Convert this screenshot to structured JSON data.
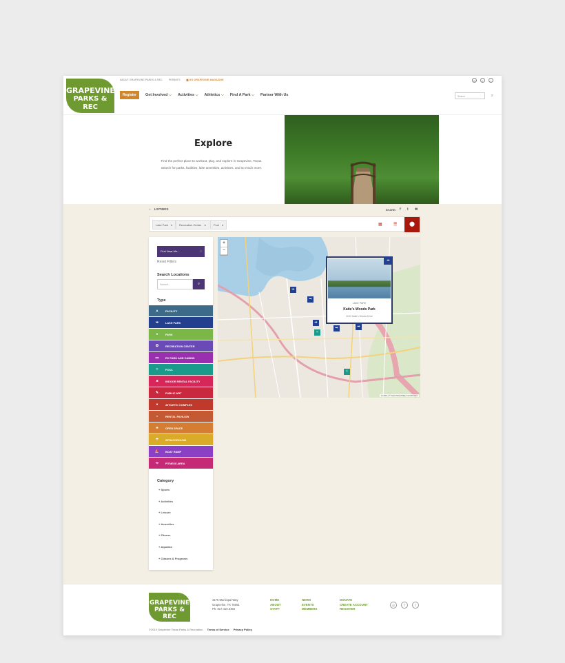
{
  "header": {
    "logo_line1": "GRAPEVINE",
    "logo_line2": "PARKS & REC",
    "util_links": [
      "ABOUT GRAPEVINE PARKS & REC",
      "PERMITS"
    ],
    "magazine_label": "GO GRAPEVINE MAGAZINE",
    "register_label": "Register",
    "nav": [
      "Get Involved",
      "Activities",
      "Athletics",
      "Find A Park",
      "Partner With Us"
    ],
    "search_placeholder": "Search",
    "social_icons": [
      "instagram-icon",
      "facebook-icon",
      "twitter-icon"
    ]
  },
  "hero": {
    "title": "Explore",
    "description": "Find the perfect place to workout, play, and explore in Grapevine, Texas. Search for parks, facilities, lake amenities, activities, and so much more."
  },
  "listing": {
    "breadcrumb": "LISTINGS",
    "share_label": "SHARE:",
    "filters": [
      "Lake Park",
      "Recreation Center",
      "Pool"
    ]
  },
  "sidebar": {
    "find_near_label": "Find Near Me...",
    "reset_label": "Reset Filters",
    "search_heading": "Search Locations",
    "search_placeholder": "Search...",
    "type_heading": "Type",
    "types": [
      {
        "label": "FACILITY",
        "color": "#3e6a8a"
      },
      {
        "label": "LAKE PARK",
        "color": "#253f8f"
      },
      {
        "label": "PARK",
        "color": "#7ab648"
      },
      {
        "label": "RECREATION CENTER",
        "color": "#6a4bb5"
      },
      {
        "label": "RV PARK AND CABINS",
        "color": "#9a2fb0"
      },
      {
        "label": "POOL",
        "color": "#1a9a8a"
      },
      {
        "label": "INDOOR RENTAL FACILITY",
        "color": "#d6265a"
      },
      {
        "label": "PUBLIC ART",
        "color": "#c9283e"
      },
      {
        "label": "ATHLETIC COMPLEX",
        "color": "#bf3a2c"
      },
      {
        "label": "RENTAL PAVILION",
        "color": "#c45a33"
      },
      {
        "label": "OPEN SPACE",
        "color": "#d67d34"
      },
      {
        "label": "SPRAYGROUND",
        "color": "#d9ab29"
      },
      {
        "label": "BOAT RAMP",
        "color": "#8a3fc4"
      },
      {
        "label": "FITNESS AREA",
        "color": "#c42a76"
      }
    ],
    "category_heading": "Category",
    "categories": [
      "Sports",
      "Activities",
      "Leisure",
      "Amenities",
      "Fitness",
      "Aquatics",
      "Classes & Programs"
    ]
  },
  "map": {
    "popup_type": "LAKE PARK",
    "popup_name": "Katie’s Woods Park",
    "popup_address": "3100 Katie's Woods Drive",
    "attribution": "Leaflet | © OpenStreetMap Contributors"
  },
  "footer": {
    "logo_line1": "GRAPEVINE",
    "logo_line2": "PARKS & REC",
    "address_line1": "3175 Municipal Way",
    "address_line2": "Grapevine, TX 76051",
    "phone": "Ph: 817.410.3450",
    "col1": [
      "HOME",
      "ABOUT",
      "STAFF"
    ],
    "col2": [
      "NEWS",
      "EVENTS",
      "MEMBERS"
    ],
    "col3": [
      "DONATE",
      "CREATE ACCOUNT",
      "REGISTER"
    ],
    "copyright": "©2019 Grapevine Texas Parks & Recreation",
    "terms": "Terms of Service",
    "privacy": "Privacy Policy"
  }
}
